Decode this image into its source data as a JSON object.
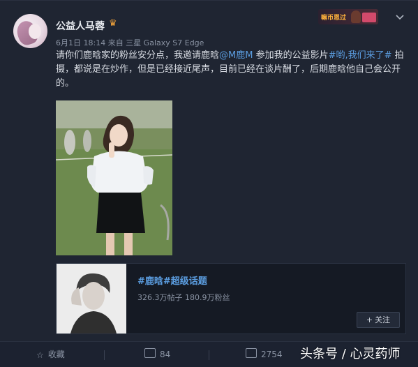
{
  "post": {
    "author": "公益人马蓉",
    "meta": "6月1日 18:14 来自 三星 Galaxy S7 Edge",
    "content_parts": {
      "p1": "请你们鹿晗家的粉丝安分点，我邀请鹿晗",
      "mention": "@M鹿M",
      "p2": " 参加我的公益影片",
      "hashtag": "#哟,我们来了#",
      "p3": " 拍摄，都说是在炒作，但是已经接近尾声，目前已经在谈片酬了，后期鹿晗他自己会公开的。"
    }
  },
  "badge": {
    "text": "嘛币恩过"
  },
  "topic_card": {
    "title": "#鹿晗#超级话题",
    "stats": "326.3万帖子 180.9万粉丝",
    "follow_label": "关注",
    "follow_plus": "+"
  },
  "actions": {
    "favorite_label": "收藏",
    "repost_count": "84",
    "comment_count": "2754"
  },
  "watermark": "头条号 / 心灵药师",
  "colors": {
    "accent_link": "#5b9de0",
    "background": "#1f2532"
  }
}
